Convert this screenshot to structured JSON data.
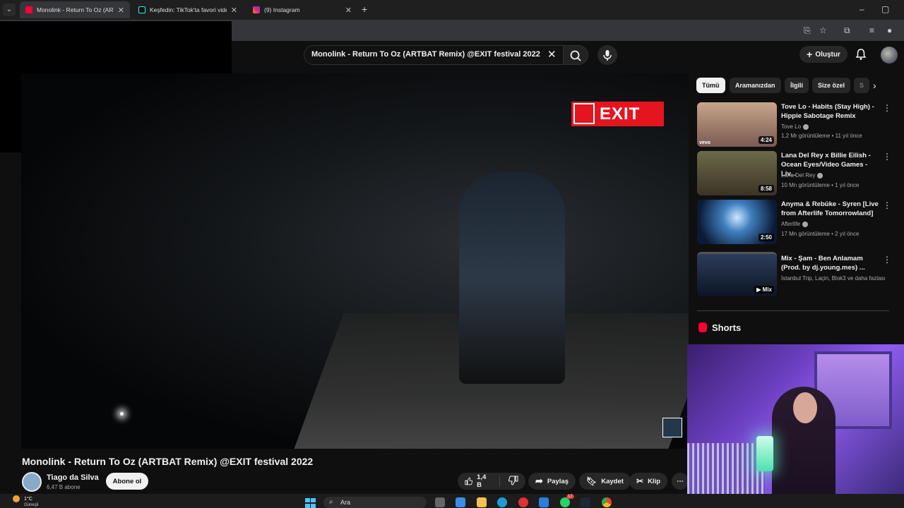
{
  "browser": {
    "tabs": [
      {
        "title": "Monolink - Return To Oz (ARTBA",
        "color": "#ff0033"
      },
      {
        "title": "Keşfedin: TikTok'ta favori videol",
        "color": "#111111"
      },
      {
        "title": "(9) Instagram",
        "color": "#d6249f"
      }
    ]
  },
  "header": {
    "search_query": "Monolink - Return To Oz (ARTBAT Remix) @EXIT festival 2022",
    "create_label": "Oluştur"
  },
  "video": {
    "logo_text": "EXIT",
    "title": "Monolink - Return To Oz (ARTBAT Remix) @EXIT festival 2022",
    "channel": "Tiago da Silva",
    "subscribers": "6,47 B abone",
    "subscribe_label": "Abone ol",
    "likes": "1,4 B",
    "share_label": "Paylaş",
    "save_label": "Kaydet",
    "clip_label": "Klip"
  },
  "sidebar": {
    "chips": [
      "Tümü",
      "Aramanızdan",
      "İlgili",
      "Size özel",
      "S"
    ],
    "videos": [
      {
        "title_line1": "Tove Lo - Habits (Stay High) -",
        "title_line2": "Hippie Sabotage Remix",
        "channel": "Tove Lo",
        "meta": "1,2 Mr görüntüleme • 11 yıl önce",
        "duration": "4:24",
        "badge": "vevo"
      },
      {
        "title_line1": "Lana Del Rey x Billie Eilish -",
        "title_line2": "Ocean Eyes/Video Games - Liv...",
        "channel": "Lana Del Rey",
        "meta": "10 Mn görüntüleme • 1 yıl önce",
        "duration": "8:58",
        "badge": ""
      },
      {
        "title_line1": "Anyma & Rebūke - Syren [Live",
        "title_line2": "from Afterlife Tomorrowland]",
        "channel": "Afterlife",
        "meta": "17 Mn görüntüleme • 2 yıl önce",
        "duration": "2:50",
        "badge": ""
      },
      {
        "title_line1": "Mix - Şam - Ben Anlamam",
        "title_line2": "(Prod. by dj.young.mes) ...",
        "channel": "İstanbul Trip, Laçin, Blok3 ve daha fazlası",
        "meta": "",
        "duration": "Mix",
        "badge": ""
      }
    ],
    "shorts_label": "Shorts"
  },
  "taskbar": {
    "temperature": "1°C",
    "weather_text": "Güneşli",
    "search_placeholder": "Ara",
    "badge_count": "17"
  }
}
